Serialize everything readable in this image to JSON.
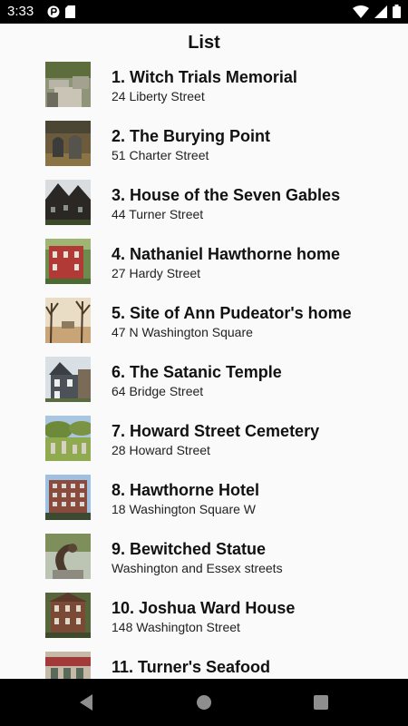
{
  "status": {
    "time": "3:33"
  },
  "header": {
    "title": "List"
  },
  "places": [
    {
      "name": "1. Witch Trials Memorial",
      "address": "24 Liberty Street"
    },
    {
      "name": "2. The Burying Point",
      "address": "51 Charter Street"
    },
    {
      "name": "3. House of the Seven Gables",
      "address": "44 Turner Street"
    },
    {
      "name": "4. Nathaniel Hawthorne home",
      "address": "27 Hardy Street"
    },
    {
      "name": "5. Site of Ann Pudeator's home",
      "address": "47 N Washington Square"
    },
    {
      "name": "6. The Satanic Temple",
      "address": "64 Bridge Street"
    },
    {
      "name": "7. Howard Street Cemetery",
      "address": "28 Howard Street"
    },
    {
      "name": "8. Hawthorne Hotel",
      "address": "18 Washington Square W"
    },
    {
      "name": "9. Bewitched Statue",
      "address": "Washington and Essex streets"
    },
    {
      "name": "10. Joshua Ward House",
      "address": "148 Washington Street"
    },
    {
      "name": "11. Turner's Seafood",
      "address": ""
    }
  ],
  "nav": {
    "back": "back-icon",
    "home": "home-icon",
    "recents": "recents-icon"
  }
}
